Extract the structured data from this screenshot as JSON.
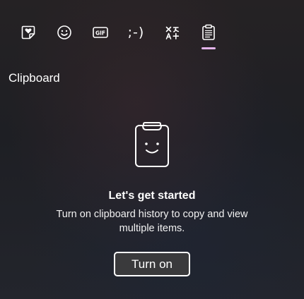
{
  "tabs": [
    {
      "id": "stickers",
      "icon": "heart-sticker-icon"
    },
    {
      "id": "emoji",
      "icon": "smiley-icon"
    },
    {
      "id": "gif",
      "icon": "gif-icon",
      "label": "GIF"
    },
    {
      "id": "kaomoji",
      "icon": "kaomoji-icon",
      "label": ";-)"
    },
    {
      "id": "symbols",
      "icon": "symbols-icon"
    },
    {
      "id": "clipboard",
      "icon": "clipboard-icon",
      "selected": true
    }
  ],
  "accent_color": "#e3b4ea",
  "section": {
    "title": "Clipboard"
  },
  "empty_state": {
    "icon": "clipboard-smiley-icon",
    "heading": "Let's get started",
    "description": "Turn on clipboard history to copy and view multiple items.",
    "button_label": "Turn on"
  }
}
